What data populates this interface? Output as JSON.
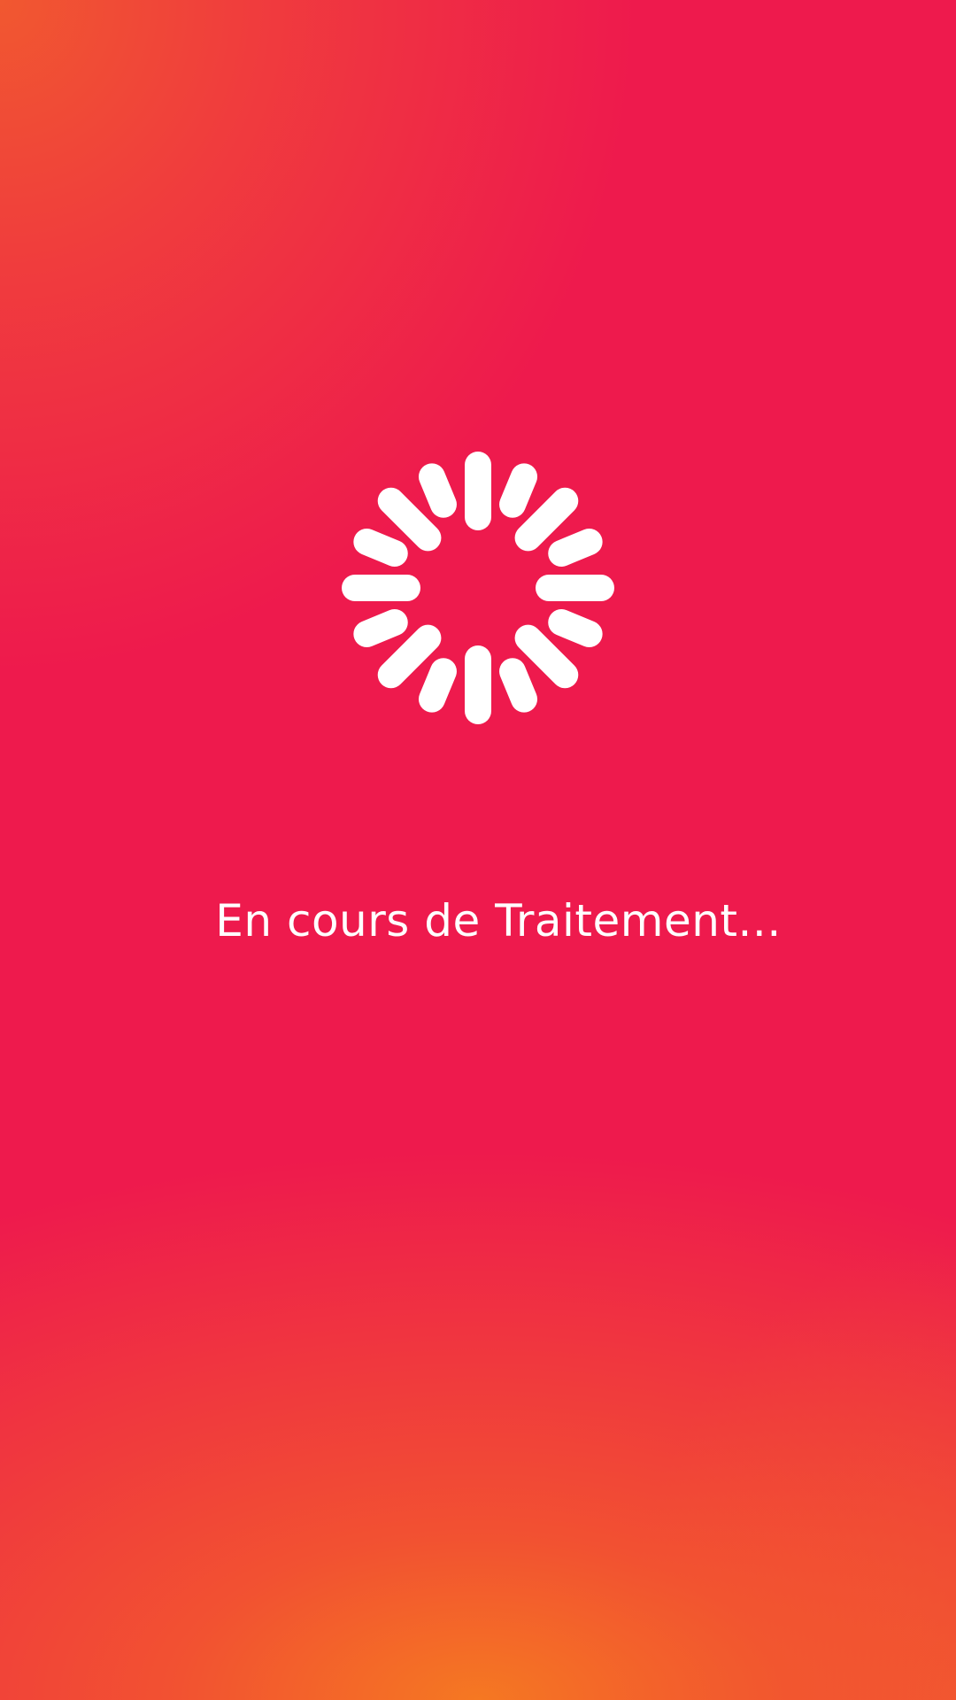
{
  "screen": {
    "background_color": "#EE1A4D",
    "gradient_accent_colors": [
      "#F15830",
      "#F57822"
    ]
  },
  "spinner": {
    "icon": "loading-spinner-icon",
    "color": "#FFFFFF"
  },
  "status": {
    "text": "En cours de Traitement..."
  }
}
